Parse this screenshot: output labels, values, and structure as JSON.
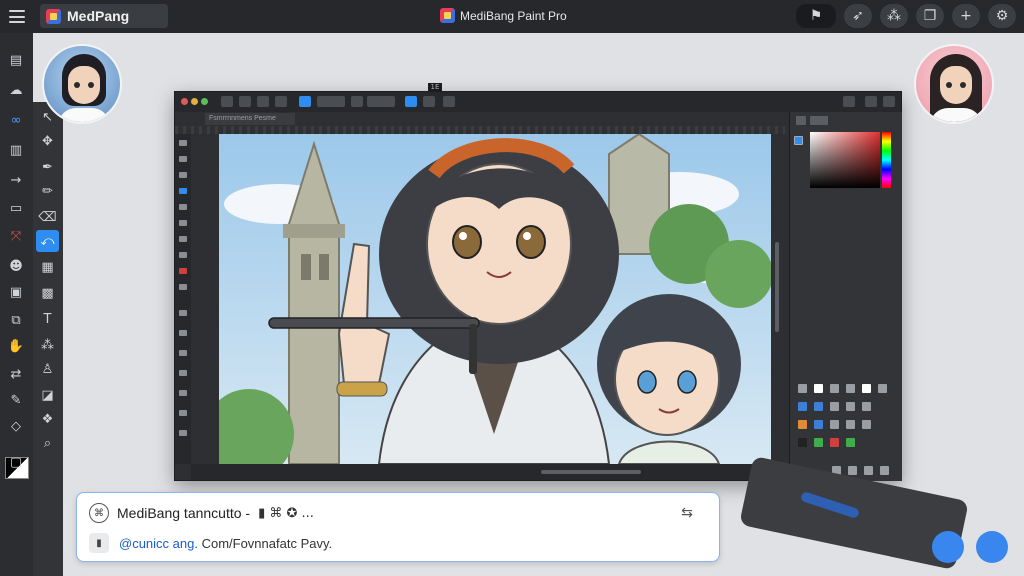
{
  "topbar": {
    "app_tab_label": "MedPang",
    "center_title": "MediBang Paint Pro",
    "icons": [
      "flag-icon",
      "send-icon",
      "cluster-icon",
      "gallery-icon",
      "plus-icon",
      "settings-icon"
    ]
  },
  "window": {
    "tab_label": "Fsmrrnnmens Pesme",
    "tooltip": "1E"
  },
  "card": {
    "title": "MediBang tanncutto -",
    "meta_glyphs": "▮ ⌘ ✪ ...",
    "link_prefix": "@cunicc ang.",
    "link_rest": " Com/Fovnnafatc Pavy."
  },
  "colors": {
    "accent": "#2f8cf0",
    "topbar_bg": "#26282c",
    "rail_bg": "#2b2d31"
  }
}
